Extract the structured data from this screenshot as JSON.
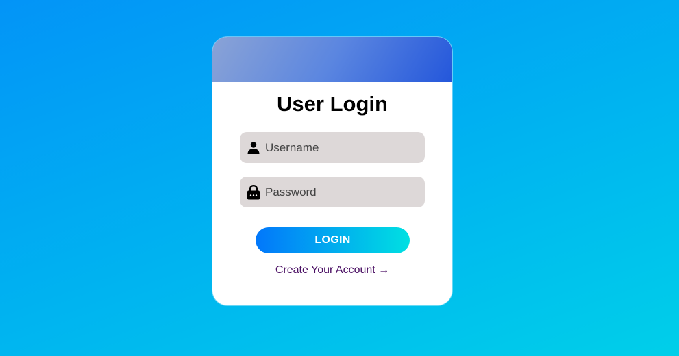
{
  "login": {
    "title": "User Login",
    "username": {
      "placeholder": "Username",
      "icon": "user-icon"
    },
    "password": {
      "placeholder": "Password",
      "icon": "lock-icon"
    },
    "login_label": "LOGIN",
    "create_account_label": "Create Your Account →"
  },
  "colors": {
    "header_gradient_start": "#8aa3d6",
    "header_gradient_end": "#2457db",
    "button_gradient_start": "#0277fb",
    "button_gradient_end": "#00e0e2",
    "field_background": "#ddd8d8",
    "link_color": "#4a0f63"
  }
}
